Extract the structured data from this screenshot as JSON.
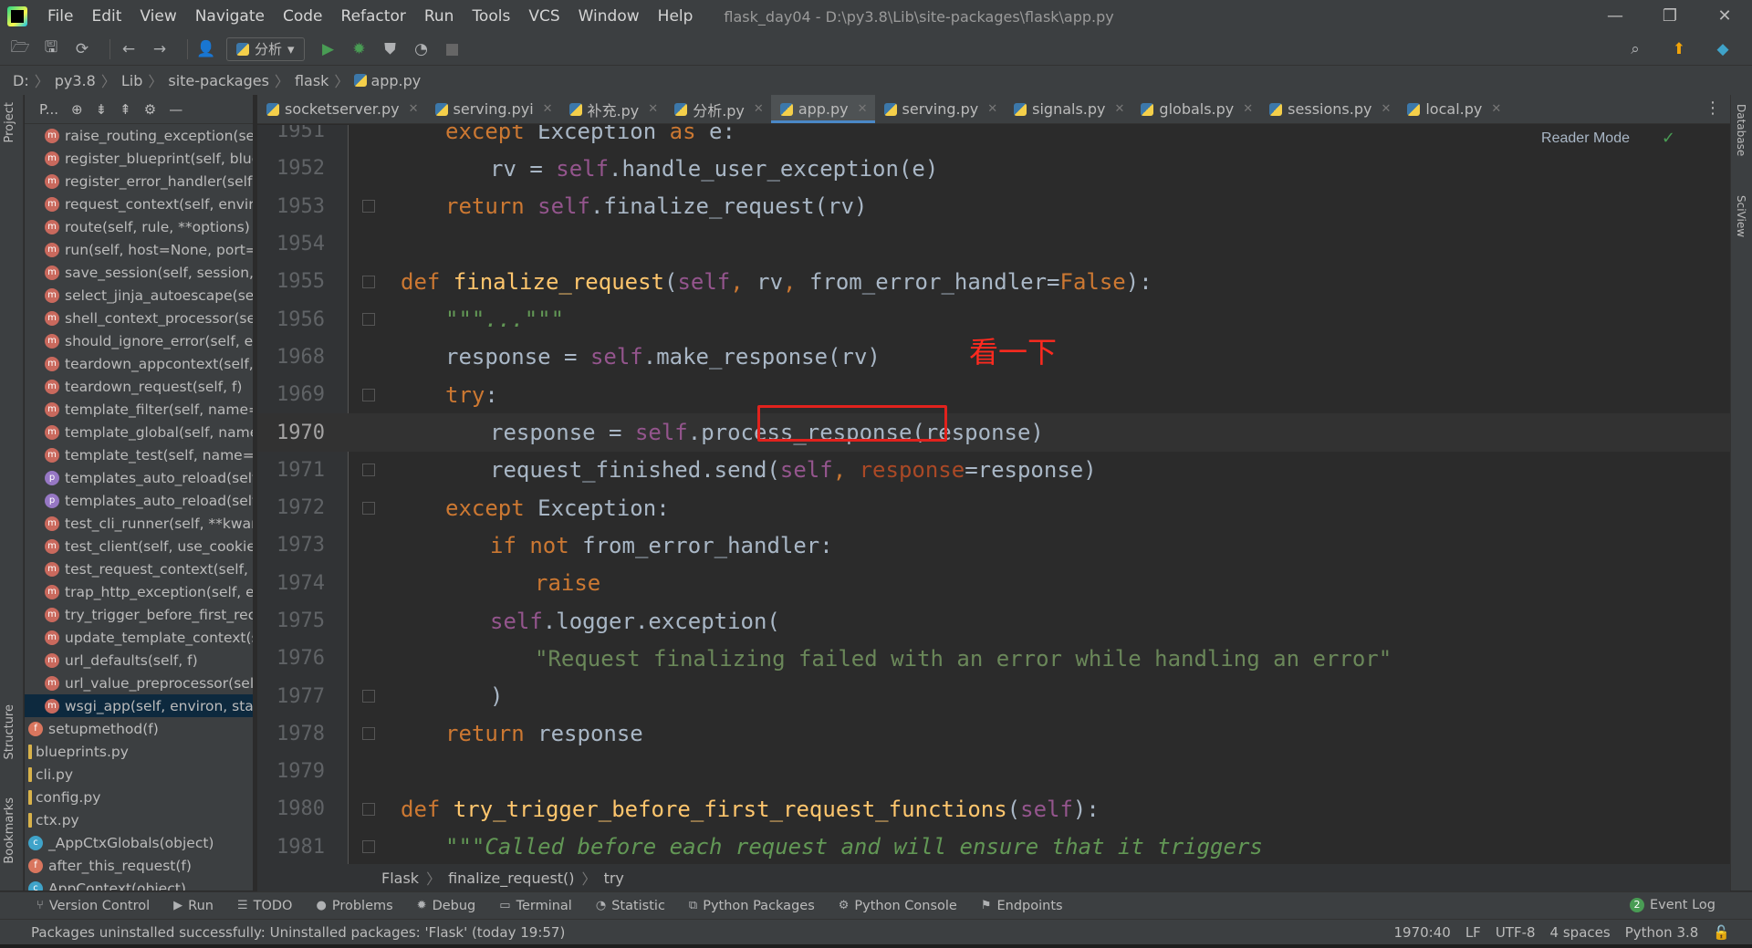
{
  "title_bar": {
    "menu": [
      "File",
      "Edit",
      "View",
      "Navigate",
      "Code",
      "Refactor",
      "Run",
      "Tools",
      "VCS",
      "Window",
      "Help"
    ],
    "window_title": "flask_day04 - D:\\py3.8\\Lib\\site-packages\\flask\\app.py"
  },
  "toolbar": {
    "run_config": "分析"
  },
  "breadcrumb": [
    "D:",
    "py3.8",
    "Lib",
    "site-packages",
    "flask",
    "app.py"
  ],
  "project_panel": {
    "header_label": "P...",
    "items": [
      {
        "icon": "m",
        "label": "raise_routing_exception(sel",
        "indent": 1
      },
      {
        "icon": "m",
        "label": "register_blueprint(self, blue",
        "indent": 1
      },
      {
        "icon": "m",
        "label": "register_error_handler(self,",
        "indent": 1
      },
      {
        "icon": "m",
        "label": "request_context(self, enviro",
        "indent": 1
      },
      {
        "icon": "m",
        "label": "route(self, rule, **options)",
        "indent": 1
      },
      {
        "icon": "m",
        "label": "run(self, host=None, port=",
        "indent": 1
      },
      {
        "icon": "m",
        "label": "save_session(self, session, r",
        "indent": 1
      },
      {
        "icon": "m",
        "label": "select_jinja_autoescape(self",
        "indent": 1
      },
      {
        "icon": "m",
        "label": "shell_context_processor(se",
        "indent": 1
      },
      {
        "icon": "m",
        "label": "should_ignore_error(self, er",
        "indent": 1
      },
      {
        "icon": "m",
        "label": "teardown_appcontext(self,",
        "indent": 1
      },
      {
        "icon": "m",
        "label": "teardown_request(self, f)",
        "indent": 1
      },
      {
        "icon": "m",
        "label": "template_filter(self, name=",
        "indent": 1
      },
      {
        "icon": "m",
        "label": "template_global(self, name",
        "indent": 1
      },
      {
        "icon": "m",
        "label": "template_test(self, name=N",
        "indent": 1
      },
      {
        "icon": "p",
        "label": "templates_auto_reload(self",
        "indent": 1
      },
      {
        "icon": "p",
        "label": "templates_auto_reload(self",
        "indent": 1
      },
      {
        "icon": "m",
        "label": "test_cli_runner(self, **kwarg",
        "indent": 1
      },
      {
        "icon": "m",
        "label": "test_client(self, use_cookies",
        "indent": 1
      },
      {
        "icon": "m",
        "label": "test_request_context(self, *",
        "indent": 1
      },
      {
        "icon": "m",
        "label": "trap_http_exception(self, e)",
        "indent": 1
      },
      {
        "icon": "m",
        "label": "try_trigger_before_first_rec",
        "indent": 1
      },
      {
        "icon": "m",
        "label": "update_template_context(s",
        "indent": 1
      },
      {
        "icon": "m",
        "label": "url_defaults(self, f)",
        "indent": 1
      },
      {
        "icon": "m",
        "label": "url_value_preprocessor(self",
        "indent": 1
      },
      {
        "icon": "m",
        "label": "wsgi_app(self, environ, star",
        "indent": 1,
        "selected": true
      },
      {
        "icon": "f",
        "label": "setupmethod(f)",
        "indent": 0
      },
      {
        "icon": "file",
        "label": "blueprints.py",
        "indent": 0
      },
      {
        "icon": "file",
        "label": "cli.py",
        "indent": 0
      },
      {
        "icon": "file",
        "label": "config.py",
        "indent": 0
      },
      {
        "icon": "file",
        "label": "ctx.py",
        "indent": 0
      },
      {
        "icon": "c",
        "label": "_AppCtxGlobals(object)",
        "indent": 0
      },
      {
        "icon": "f",
        "label": "after_this_request(f)",
        "indent": 0
      },
      {
        "icon": "c",
        "label": "AppContext(object)",
        "indent": 0
      }
    ]
  },
  "left_strip": {
    "project": "Project",
    "structure": "Structure",
    "bookmarks": "Bookmarks"
  },
  "right_strip": {
    "database": "Database",
    "sciview": "SciView"
  },
  "tabs": [
    {
      "label": "socketserver.py",
      "active": false
    },
    {
      "label": "serving.pyi",
      "active": false
    },
    {
      "label": "补充.py",
      "active": false
    },
    {
      "label": "分析.py",
      "active": false
    },
    {
      "label": "app.py",
      "active": true
    },
    {
      "label": "serving.py",
      "active": false
    },
    {
      "label": "signals.py",
      "active": false
    },
    {
      "label": "globals.py",
      "active": false
    },
    {
      "label": "sessions.py",
      "active": false
    },
    {
      "label": "local.py",
      "active": false
    }
  ],
  "editor": {
    "reader_mode": "Reader Mode",
    "annotation": "看一下",
    "current_line": "1970",
    "lines": [
      {
        "n": "1951",
        "indent": 2,
        "tokens": [
          [
            "kw",
            "except "
          ],
          [
            "cls",
            "Exception "
          ],
          [
            "kw",
            "as "
          ],
          [
            "cls",
            "e:"
          ]
        ]
      },
      {
        "n": "1952",
        "indent": 3,
        "tokens": [
          [
            "cls",
            "rv = "
          ],
          [
            "self",
            "self"
          ],
          [
            "cls",
            ".handle_user_exception(e)"
          ]
        ]
      },
      {
        "n": "1953",
        "indent": 2,
        "tokens": [
          [
            "kw",
            "return "
          ],
          [
            "self",
            "self"
          ],
          [
            "cls",
            ".finalize_request(rv)"
          ]
        ]
      },
      {
        "n": "1954",
        "indent": 0,
        "tokens": []
      },
      {
        "n": "1955",
        "indent": 1,
        "tokens": [
          [
            "kw",
            "def "
          ],
          [
            "fn",
            "finalize_request"
          ],
          [
            "cls",
            "("
          ],
          [
            "self",
            "self"
          ],
          [
            "kw",
            ", "
          ],
          [
            "cls",
            "rv"
          ],
          [
            "kw",
            ", "
          ],
          [
            "cls",
            "from_error_handler="
          ],
          [
            "kw",
            "False"
          ],
          [
            "cls",
            "):"
          ]
        ]
      },
      {
        "n": "1956",
        "indent": 2,
        "tokens": [
          [
            "doc",
            "\"\"\"...\"\"\""
          ]
        ]
      },
      {
        "n": "1968",
        "indent": 2,
        "tokens": [
          [
            "cls",
            "response = "
          ],
          [
            "self",
            "self"
          ],
          [
            "cls",
            ".make_response(rv)"
          ]
        ]
      },
      {
        "n": "1969",
        "indent": 2,
        "tokens": [
          [
            "kw",
            "try"
          ],
          [
            "cls",
            ":"
          ]
        ]
      },
      {
        "n": "1970",
        "indent": 3,
        "tokens": [
          [
            "cls",
            "response = "
          ],
          [
            "self",
            "self"
          ],
          [
            "cls",
            ".process_response(response)"
          ]
        ]
      },
      {
        "n": "1971",
        "indent": 3,
        "tokens": [
          [
            "cls",
            "request_finished.send("
          ],
          [
            "self",
            "self"
          ],
          [
            "kw",
            ", "
          ],
          [
            "param",
            "response"
          ],
          [
            "cls",
            "=response)"
          ]
        ]
      },
      {
        "n": "1972",
        "indent": 2,
        "tokens": [
          [
            "kw",
            "except "
          ],
          [
            "cls",
            "Exception:"
          ]
        ]
      },
      {
        "n": "1973",
        "indent": 3,
        "tokens": [
          [
            "kw",
            "if not "
          ],
          [
            "cls",
            "from_error_handler:"
          ]
        ]
      },
      {
        "n": "1974",
        "indent": 4,
        "tokens": [
          [
            "kw",
            "raise"
          ]
        ]
      },
      {
        "n": "1975",
        "indent": 3,
        "tokens": [
          [
            "self",
            "self"
          ],
          [
            "cls",
            ".logger.exception("
          ]
        ]
      },
      {
        "n": "1976",
        "indent": 4,
        "tokens": [
          [
            "str",
            "\"Request finalizing failed with an error while handling an error\""
          ]
        ]
      },
      {
        "n": "1977",
        "indent": 3,
        "tokens": [
          [
            "cls",
            ")"
          ]
        ]
      },
      {
        "n": "1978",
        "indent": 2,
        "tokens": [
          [
            "kw",
            "return "
          ],
          [
            "cls",
            "response"
          ]
        ]
      },
      {
        "n": "1979",
        "indent": 0,
        "tokens": []
      },
      {
        "n": "1980",
        "indent": 1,
        "tokens": [
          [
            "kw",
            "def "
          ],
          [
            "fn",
            "try_trigger_before_first_request_functions"
          ],
          [
            "cls",
            "("
          ],
          [
            "self",
            "self"
          ],
          [
            "cls",
            "):"
          ]
        ]
      },
      {
        "n": "1981",
        "indent": 2,
        "tokens": [
          [
            "doc",
            "\"\"\"Called before each request and will ensure that it triggers"
          ]
        ]
      }
    ]
  },
  "editor_breadcrumb": [
    "Flask",
    "finalize_request()",
    "try"
  ],
  "tool_windows": [
    "Version Control",
    "Run",
    "TODO",
    "Problems",
    "Debug",
    "Terminal",
    "Statistic",
    "Python Packages",
    "Python Console",
    "Endpoints"
  ],
  "event_log": {
    "count": "2",
    "label": "Event Log"
  },
  "status_bar": {
    "message": "Packages uninstalled successfully: Uninstalled packages: 'Flask' (today 19:57)",
    "position": "1970:40",
    "line_sep": "LF",
    "encoding": "UTF-8",
    "indent": "4 spaces",
    "interpreter": "Python 3.8"
  },
  "colors": {
    "accent": "#4a88c7",
    "highlight_box": "#e1221d",
    "annotation": "#ff2a1f"
  }
}
